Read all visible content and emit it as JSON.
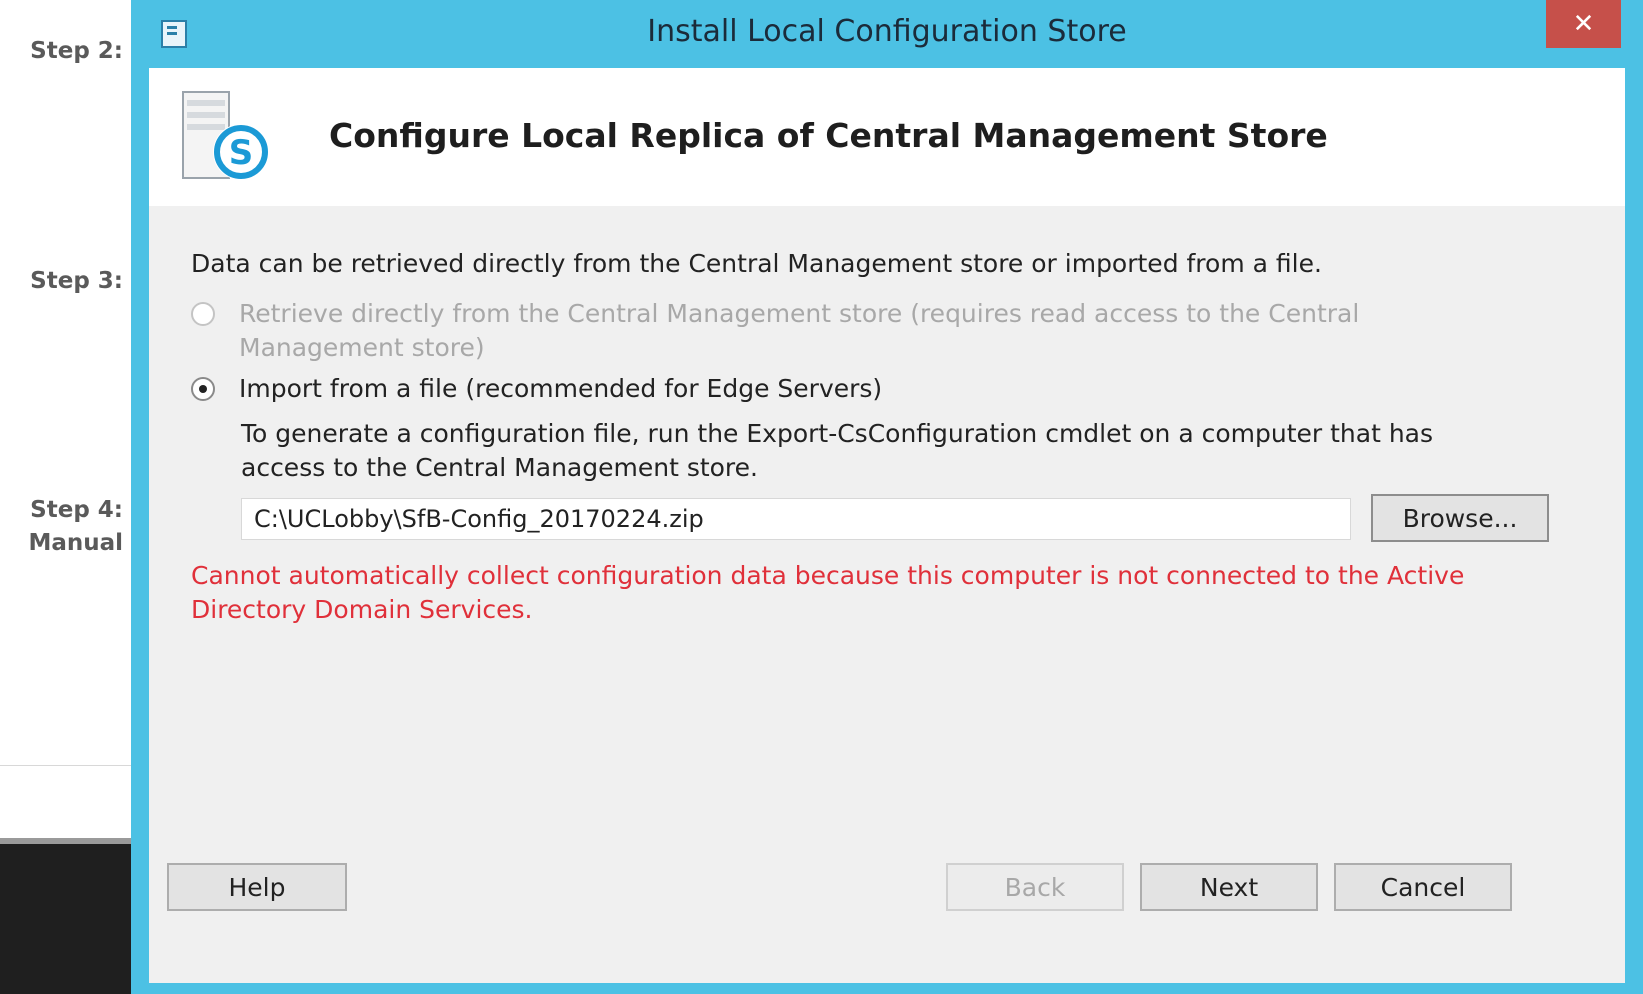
{
  "background": {
    "steps": [
      {
        "label": "Step 2:"
      },
      {
        "label": "Step 3:"
      },
      {
        "label": "Step 4:"
      },
      {
        "label": "Manual"
      }
    ]
  },
  "dialog": {
    "title": "Install Local Configuration Store",
    "close_glyph": "✕",
    "header": {
      "title": "Configure Local Replica of Central Management Store",
      "icon": "skype-server-icon"
    },
    "intro": "Data can be retrieved directly from the Central Management store or imported from a file.",
    "options": [
      {
        "line1": "Retrieve directly from the Central Management store (requires read access to the Central",
        "line2": "Management store)",
        "selected": false,
        "enabled": false
      },
      {
        "line1": "Import from a file (recommended for Edge Servers)",
        "selected": true,
        "enabled": true
      }
    ],
    "import_hint": {
      "line1": "To generate a configuration file, run the Export-CsConfiguration cmdlet on a computer that has",
      "line2": "access to the Central Management store."
    },
    "file_path": "C:\\UCLobby\\SfB-Config_20170224.zip",
    "browse_label": "Browse...",
    "error": {
      "line1": "Cannot automatically collect configuration data because this computer is not connected to the Active",
      "line2": "Directory Domain Services.",
      "color": "#e0303a"
    },
    "buttons": {
      "help": "Help",
      "back": "Back",
      "next": "Next",
      "cancel": "Cancel"
    },
    "colors": {
      "frame": "#4cc1e4",
      "close": "#c6504a"
    }
  }
}
